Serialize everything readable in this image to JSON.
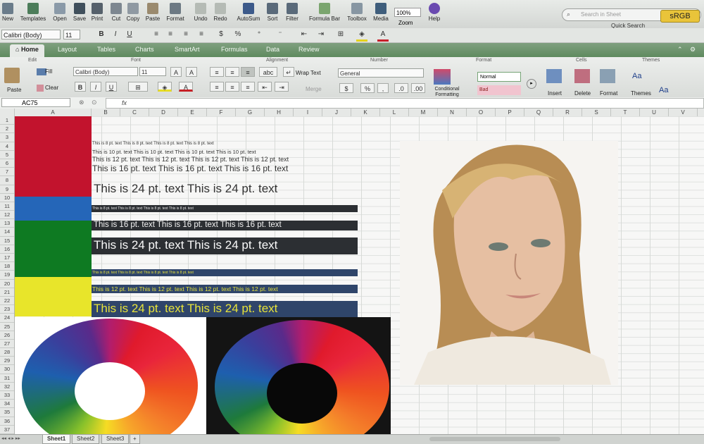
{
  "toolbar": {
    "buttons": [
      {
        "label": "New"
      },
      {
        "label": "Templates"
      },
      {
        "label": "Open"
      },
      {
        "label": "Save"
      },
      {
        "label": "Print"
      },
      {
        "label": "Cut"
      },
      {
        "label": "Copy"
      },
      {
        "label": "Paste"
      },
      {
        "label": "Format"
      },
      {
        "label": "Undo"
      },
      {
        "label": "Redo"
      },
      {
        "label": "AutoSum"
      },
      {
        "label": "Sort"
      },
      {
        "label": "Filter"
      },
      {
        "label": "Formula Bar"
      },
      {
        "label": "Toolbox"
      },
      {
        "label": "Media"
      },
      {
        "label": "Zoom"
      },
      {
        "label": "Help"
      }
    ],
    "zoom_value": "100%",
    "search_placeholder": "Search in Sheet",
    "quick_search": "Quick Search",
    "profile": "sRGB"
  },
  "format_row": {
    "font": "Calibri (Body)",
    "size": "11"
  },
  "tabs": [
    "Home",
    "Layout",
    "Tables",
    "Charts",
    "SmartArt",
    "Formulas",
    "Data",
    "Review"
  ],
  "ribbon": {
    "groups": [
      "Edit",
      "Font",
      "Alignment",
      "Number",
      "Format",
      "Cells",
      "Themes"
    ],
    "paste": "Paste",
    "fill": "Fill",
    "clear": "Clear",
    "font": "Calibri (Body)",
    "size": "11",
    "wrap_text": "Wrap Text",
    "merge": "Merge",
    "abc": "abc",
    "number_format": "General",
    "conditional": "Conditional Formatting",
    "style_normal": "Normal",
    "style_bad": "Bad",
    "insert": "Insert",
    "delete": "Delete",
    "format": "Format",
    "themes": "Themes",
    "theme_fonts": "Aa"
  },
  "formula_bar": {
    "cell": "AC75",
    "fx": "fx"
  },
  "columns": [
    "A",
    "B",
    "C",
    "D",
    "E",
    "F",
    "G",
    "H",
    "I",
    "J",
    "K",
    "L",
    "M",
    "N",
    "O",
    "P",
    "Q",
    "R",
    "S",
    "T",
    "U",
    "V"
  ],
  "rows": [
    "1",
    "2",
    "3",
    "4",
    "5",
    "6",
    "7",
    "8",
    "9",
    "10",
    "11",
    "12",
    "13",
    "14",
    "15",
    "16",
    "17",
    "18",
    "19",
    "20",
    "21",
    "22",
    "23",
    "24",
    "25",
    "26",
    "27",
    "28",
    "29",
    "30",
    "31",
    "32",
    "33",
    "34",
    "35",
    "36",
    "37"
  ],
  "sheet_text": {
    "r4": "This is 8 pt. text   This is 8 pt. text   This is 8 pt. text   This is 8 pt. text",
    "r5": "This is 10 pt. text   This is 10 pt. text   This is 10 pt. text   This is 10 pt. text",
    "r6": "This is 12 pt. text   This is 12 pt. text   This is 12 pt. text   This is 12 pt. text",
    "r7": "This is 16 pt. text   This is 16 pt. text   This is 16 pt. text",
    "r9": "This is 24 pt. text   This is 24 pt. text",
    "r11": "This is 8 pt. text   This is 8 pt. text   This is 8 pt. text   This is 8 pt. text",
    "r13": "This is 16 pt. text   This is 16 pt. text   This is 16 pt. text",
    "r15": "This is 24 pt. text   This is 24 pt. text",
    "r18": "This is 8 pt. text   This is 8 pt. text   This is 8 pt. text   This is 8 pt. text",
    "r20": "This is 12 pt. text   This is 12 pt. text   This is 12 pt. text   This is 12 pt. text",
    "r22": "This is 24 pt. text   This is 24 pt. text"
  },
  "colors": {
    "red": "#c2132d",
    "blue": "#2566b8",
    "green": "#0e7a22",
    "yellow": "#e8e52a",
    "accent": "#6f9b6f"
  },
  "sheets": [
    "Sheet1",
    "Sheet2",
    "Sheet3"
  ]
}
